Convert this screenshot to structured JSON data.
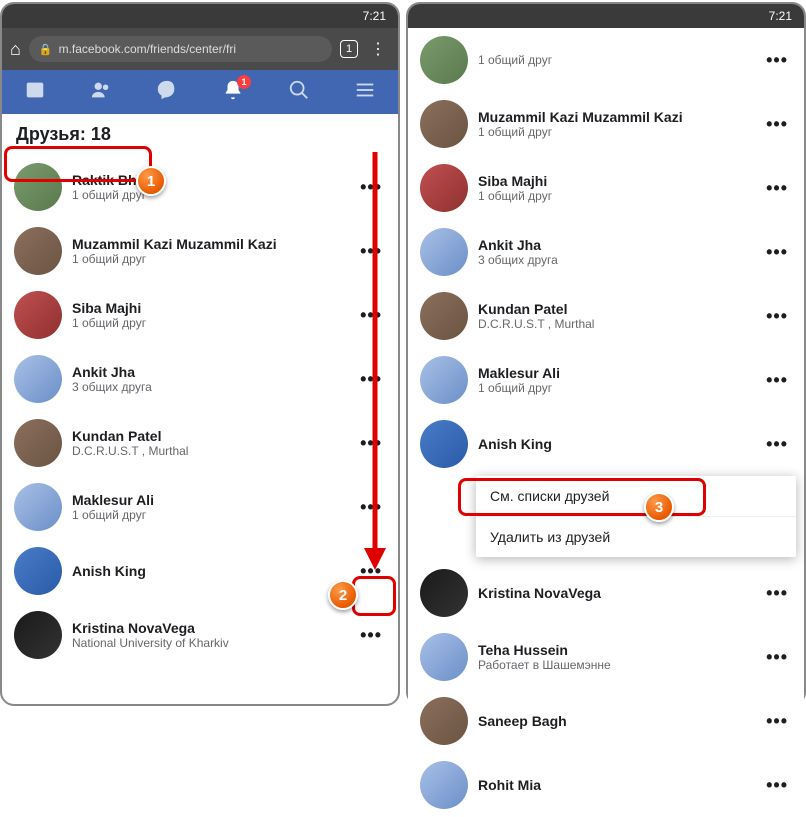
{
  "status": {
    "time": "7:21"
  },
  "browser": {
    "url": "m.facebook.com/friends/center/fri",
    "tabs": "1"
  },
  "nav": {
    "badge": "1"
  },
  "header": {
    "title": "Друзья: 18"
  },
  "left_friends": [
    {
      "name": "Raktik Bh...",
      "sub": "1 общий друг",
      "av": "green"
    },
    {
      "name": "Muzammil Kazi Muzammil Kazi",
      "sub": "1 общий друг",
      "av": "brown"
    },
    {
      "name": "Siba Majhi",
      "sub": "1 общий друг",
      "av": "red"
    },
    {
      "name": "Ankit Jha",
      "sub": "3 общих друга",
      "av": ""
    },
    {
      "name": "Kundan Patel",
      "sub": "D.C.R.U.S.T , Murthal",
      "av": "brown"
    },
    {
      "name": "Maklesur Ali",
      "sub": "1 общий друг",
      "av": ""
    },
    {
      "name": "Anish King",
      "sub": "",
      "av": "blue"
    },
    {
      "name": "Kristina NovaVega",
      "sub": "National University of Kharkiv",
      "av": "dark"
    }
  ],
  "right_friends": [
    {
      "name": "",
      "sub": "1 общий друг",
      "av": "green"
    },
    {
      "name": "Muzammil Kazi Muzammil Kazi",
      "sub": "1 общий друг",
      "av": "brown"
    },
    {
      "name": "Siba Majhi",
      "sub": "1 общий друг",
      "av": "red"
    },
    {
      "name": "Ankit Jha",
      "sub": "3 общих друга",
      "av": ""
    },
    {
      "name": "Kundan Patel",
      "sub": "D.C.R.U.S.T , Murthal",
      "av": "brown"
    },
    {
      "name": "Maklesur Ali",
      "sub": "1 общий друг",
      "av": ""
    },
    {
      "name": "Anish King",
      "sub": "",
      "av": "blue"
    },
    {
      "name": "Kristina NovaVega",
      "sub": "",
      "av": "dark"
    },
    {
      "name": "Teha Hussein",
      "sub": "Работает в Шашемэнне",
      "av": ""
    },
    {
      "name": "Saneep Bagh",
      "sub": "",
      "av": "brown"
    },
    {
      "name": "Rohit Mia",
      "sub": "",
      "av": ""
    }
  ],
  "popup": {
    "item1": "См. списки друзей",
    "item2": "Удалить из друзей"
  },
  "markers": {
    "m1": "1",
    "m2": "2",
    "m3": "3"
  }
}
